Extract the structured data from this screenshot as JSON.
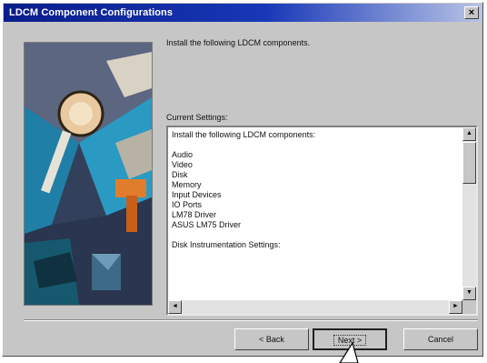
{
  "window": {
    "title": "LDCM Component Configurations",
    "close_label": "×"
  },
  "main": {
    "instruction": "Install the following LDCM components.",
    "settings_label": "Current Settings:",
    "settings_lines": [
      "Install the following LDCM components:",
      "",
      "Audio",
      "Video",
      "Disk",
      "Memory",
      "Input Devices",
      "IO Ports",
      "LM78 Driver",
      "ASUS LM75 Driver",
      "",
      "Disk Instrumentation Settings:"
    ]
  },
  "scrollbar": {
    "up_arrow": "▲",
    "down_arrow": "▼",
    "left_arrow": "◄",
    "right_arrow": "►"
  },
  "buttons": {
    "back": "< Back",
    "next": "Next >",
    "cancel": "Cancel"
  },
  "colors": {
    "title_bar": "#0a1d8a",
    "dialog_face": "#c6c6c6"
  }
}
